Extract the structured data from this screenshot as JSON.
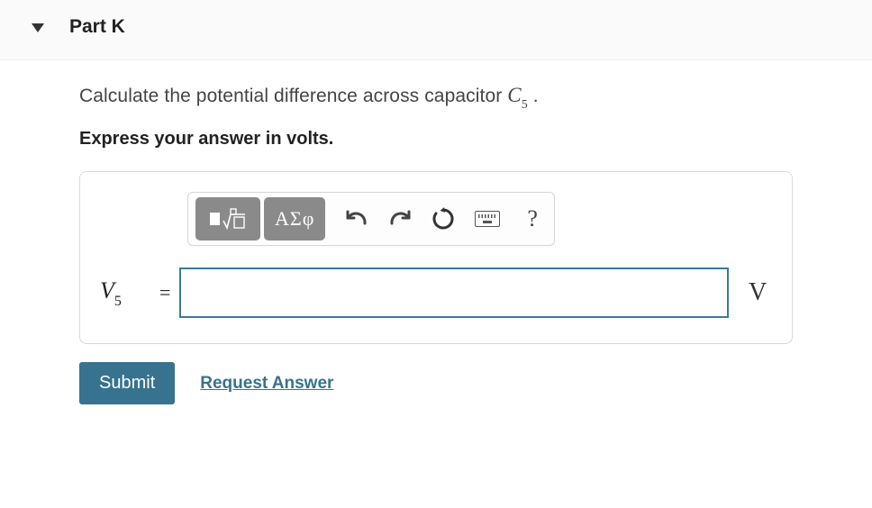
{
  "header": {
    "part_label": "Part K"
  },
  "question": {
    "prefix": "Calculate the potential difference across capacitor ",
    "var": "C",
    "sub": "5",
    "suffix": " ."
  },
  "instruction": "Express your answer in volts.",
  "toolbar": {
    "greek_label": "ΑΣφ",
    "help_label": "?"
  },
  "answer": {
    "var": "V",
    "sub": "5",
    "eq": "=",
    "value": "",
    "unit": "V"
  },
  "actions": {
    "submit": "Submit",
    "request": "Request Answer"
  }
}
